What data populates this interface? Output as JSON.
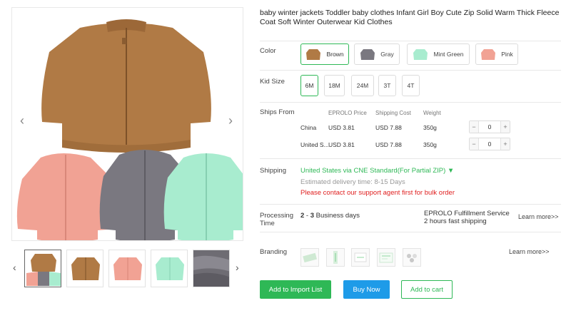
{
  "product": {
    "title": "baby winter jackets Toddler baby clothes Infant Girl Boy Cute Zip Solid Warm Thick Fleece Coat Soft Winter Outerwear Kid Clothes"
  },
  "gallery": {
    "prev_icon": "‹",
    "next_icon": "›",
    "thumb_prev_icon": "‹",
    "thumb_next_icon": "›",
    "colors": {
      "brown": "#b07a45",
      "pink": "#f1a294",
      "gray": "#7a7880",
      "mint": "#a8eccf"
    }
  },
  "color": {
    "label": "Color",
    "options": [
      {
        "name": "Brown",
        "swatch": "#b07a45"
      },
      {
        "name": "Gray",
        "swatch": "#7a7880"
      },
      {
        "name": "Mint Green",
        "swatch": "#a8eccf"
      },
      {
        "name": "Pink",
        "swatch": "#f1a294"
      }
    ],
    "selected": "Brown"
  },
  "size": {
    "label": "Kid Size",
    "options": [
      "6M",
      "18M",
      "24M",
      "3T",
      "4T"
    ],
    "selected": "6M"
  },
  "ships": {
    "label": "Ships From",
    "headers": {
      "price": "EPROLO Price",
      "shipping": "Shipping Cost",
      "weight": "Weight"
    },
    "rows": [
      {
        "origin": "China",
        "price": "USD 3.81",
        "shipping": "USD 7.88",
        "weight": "350g",
        "qty": "0",
        "minus": "−",
        "plus": "+"
      },
      {
        "origin": "United S...",
        "price": "USD 3.81",
        "shipping": "USD 7.88",
        "weight": "350g",
        "qty": "0",
        "minus": "−",
        "plus": "+"
      }
    ]
  },
  "shipping": {
    "label": "Shipping",
    "method": "United States via CNE Standard(For Partial ZIP) ▼",
    "delivery": "Estimated delivery time: 8-15 Days",
    "notice": "Please contact our support agent first for bulk order"
  },
  "processing": {
    "label_line1": "Processing",
    "label_line2": "Time",
    "days_from": "2",
    "days_sep": " - ",
    "days_to": "3",
    "days_unit": " Business days",
    "service_title": "EPROLO Fulfillment Service",
    "service_sub": "2 hours fast shipping",
    "learn_more": "Learn more>>"
  },
  "branding": {
    "label": "Branding",
    "learn_more": "Learn more>>"
  },
  "actions": {
    "import": "Add to Import List",
    "buy": "Buy Now",
    "cart": "Add to cart"
  }
}
